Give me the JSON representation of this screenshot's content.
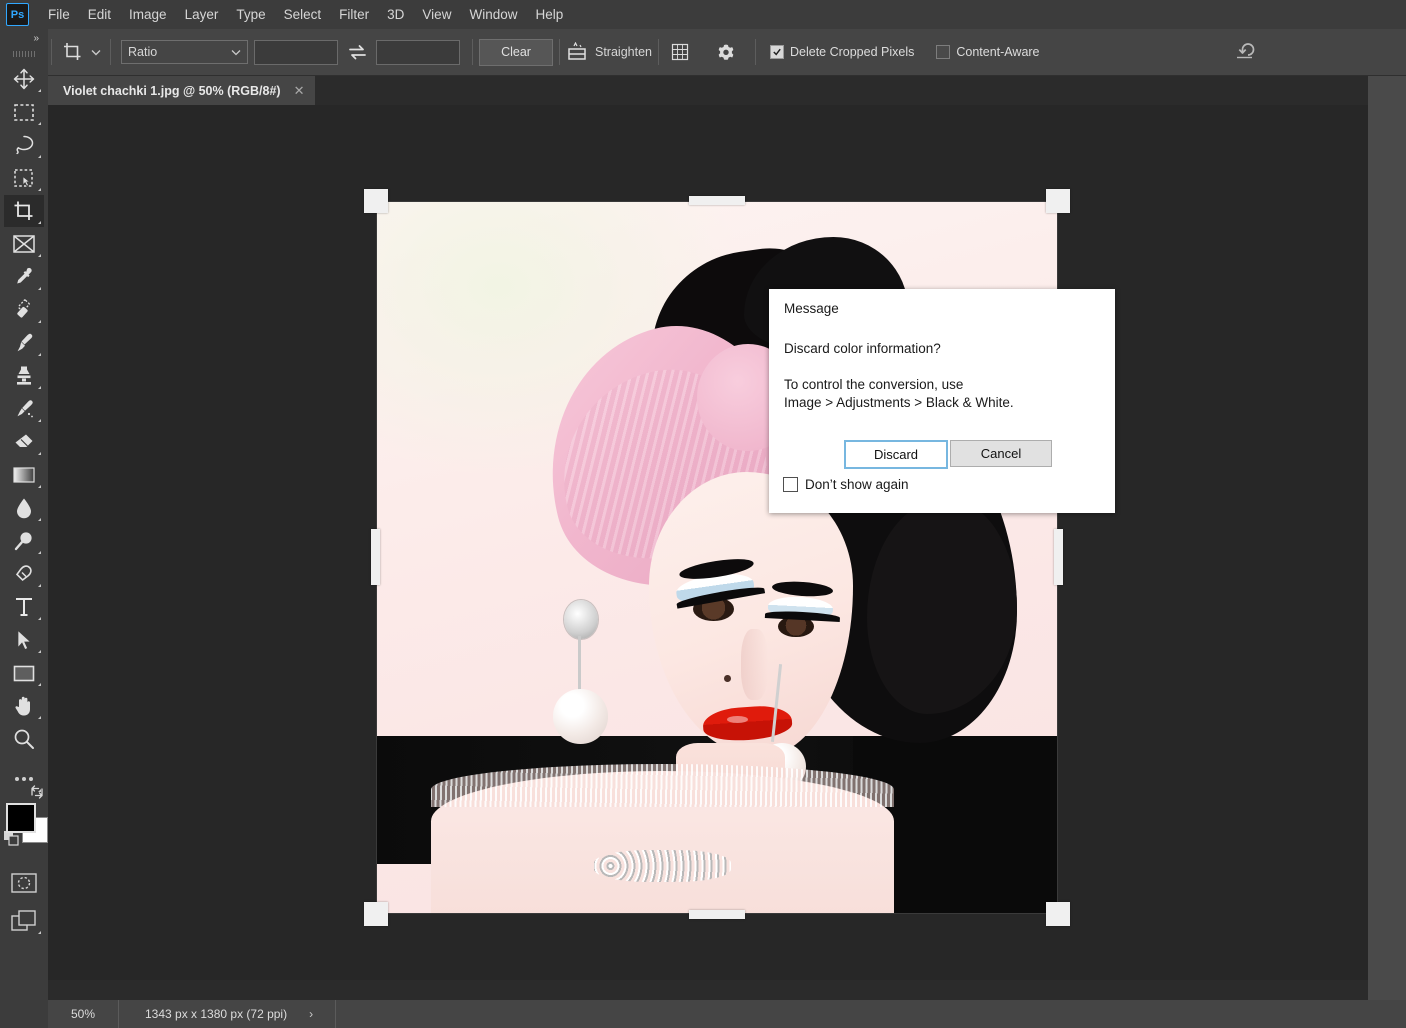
{
  "app": {
    "name": "Photoshop",
    "logo_text": "Ps"
  },
  "menubar": {
    "items": [
      {
        "label": "File"
      },
      {
        "label": "Edit"
      },
      {
        "label": "Image"
      },
      {
        "label": "Layer"
      },
      {
        "label": "Type"
      },
      {
        "label": "Select"
      },
      {
        "label": "Filter"
      },
      {
        "label": "3D"
      },
      {
        "label": "View"
      },
      {
        "label": "Window"
      },
      {
        "label": "Help"
      }
    ]
  },
  "options_bar": {
    "home_icon": "home-icon",
    "tool_icon": "crop-tool-icon",
    "preset_caret": "chevron-down-icon",
    "ratio_select": {
      "value": "Ratio",
      "caret": "chevron-down-icon"
    },
    "width_field": {
      "value": "",
      "placeholder": ""
    },
    "swap_icon": "swap-arrows-icon",
    "height_field": {
      "value": "",
      "placeholder": ""
    },
    "clear_button": "Clear",
    "straighten_icon": "straighten-icon",
    "straighten_label": "Straighten",
    "overlay_icon": "grid-overlay-icon",
    "settings_icon": "gear-icon",
    "delete_cropped": {
      "label": "Delete Cropped Pixels",
      "checked": true
    },
    "content_aware": {
      "label": "Content-Aware",
      "checked": false
    },
    "reset_icon": "reset-rotate-icon"
  },
  "tabs": [
    {
      "title": "Violet chachki 1.jpg @ 50% (RGB/8#)",
      "close_icon": "close-icon",
      "active": true
    }
  ],
  "toolbar": {
    "expand_icon": "double-chevron-right-icon",
    "tools": [
      {
        "name": "move-tool",
        "icon": "move-icon",
        "active": false
      },
      {
        "name": "rectangular-marquee-tool",
        "icon": "marquee-rect-icon",
        "active": false
      },
      {
        "name": "lasso-tool",
        "icon": "lasso-icon",
        "active": false
      },
      {
        "name": "object-selection-tool",
        "icon": "object-select-icon",
        "active": false
      },
      {
        "name": "crop-tool",
        "icon": "crop-icon",
        "active": true
      },
      {
        "name": "frame-tool",
        "icon": "frame-icon",
        "active": false
      },
      {
        "name": "eyedropper-tool",
        "icon": "eyedropper-icon",
        "active": false
      },
      {
        "name": "spot-healing-brush-tool",
        "icon": "healing-brush-icon",
        "active": false
      },
      {
        "name": "brush-tool",
        "icon": "brush-icon",
        "active": false
      },
      {
        "name": "clone-stamp-tool",
        "icon": "clone-stamp-icon",
        "active": false
      },
      {
        "name": "history-brush-tool",
        "icon": "history-brush-icon",
        "active": false
      },
      {
        "name": "eraser-tool",
        "icon": "eraser-icon",
        "active": false
      },
      {
        "name": "gradient-tool",
        "icon": "gradient-icon",
        "active": false
      },
      {
        "name": "blur-tool",
        "icon": "blur-drop-icon",
        "active": false
      },
      {
        "name": "dodge-tool",
        "icon": "dodge-icon",
        "active": false
      },
      {
        "name": "pen-tool",
        "icon": "pen-icon",
        "active": false
      },
      {
        "name": "horizontal-type-tool",
        "icon": "type-t-icon",
        "active": false
      },
      {
        "name": "path-selection-tool",
        "icon": "path-arrow-icon",
        "active": false
      },
      {
        "name": "rectangle-tool",
        "icon": "rectangle-icon",
        "active": false
      },
      {
        "name": "hand-tool",
        "icon": "hand-icon",
        "active": false
      },
      {
        "name": "zoom-tool",
        "icon": "magnifier-icon",
        "active": false
      },
      {
        "name": "edit-toolbar",
        "icon": "ellipsis-icon",
        "active": false
      }
    ],
    "foreground_color": "#000000",
    "background_color": "#ffffff",
    "swap_colors_icon": "swap-colors-icon",
    "default_colors_icon": "default-colors-icon",
    "quick_mask_icon": "quick-mask-icon",
    "screen_mode_icon": "screen-mode-icon"
  },
  "dialog": {
    "title": "Message",
    "question": "Discard color information?",
    "body_line1": "To control the conversion, use",
    "body_line2": "Image > Adjustments > Black & White.",
    "discard_button": "Discard",
    "cancel_button": "Cancel",
    "dont_show_again": {
      "label": "Don’t show again",
      "checked": false
    }
  },
  "status_bar": {
    "zoom": "50%",
    "doc_info": "1343 px x 1380 px (72 ppi)",
    "expand_arrow": "›"
  },
  "colors": {
    "menubar_bg": "#3c3c3c",
    "options_bg": "#454545",
    "panel_bg": "#3c3c3c",
    "canvas_bg": "#272727",
    "accent_blue": "#31a8ff",
    "dialog_bg": "#ffffff",
    "focus_border": "#77b7e0"
  }
}
